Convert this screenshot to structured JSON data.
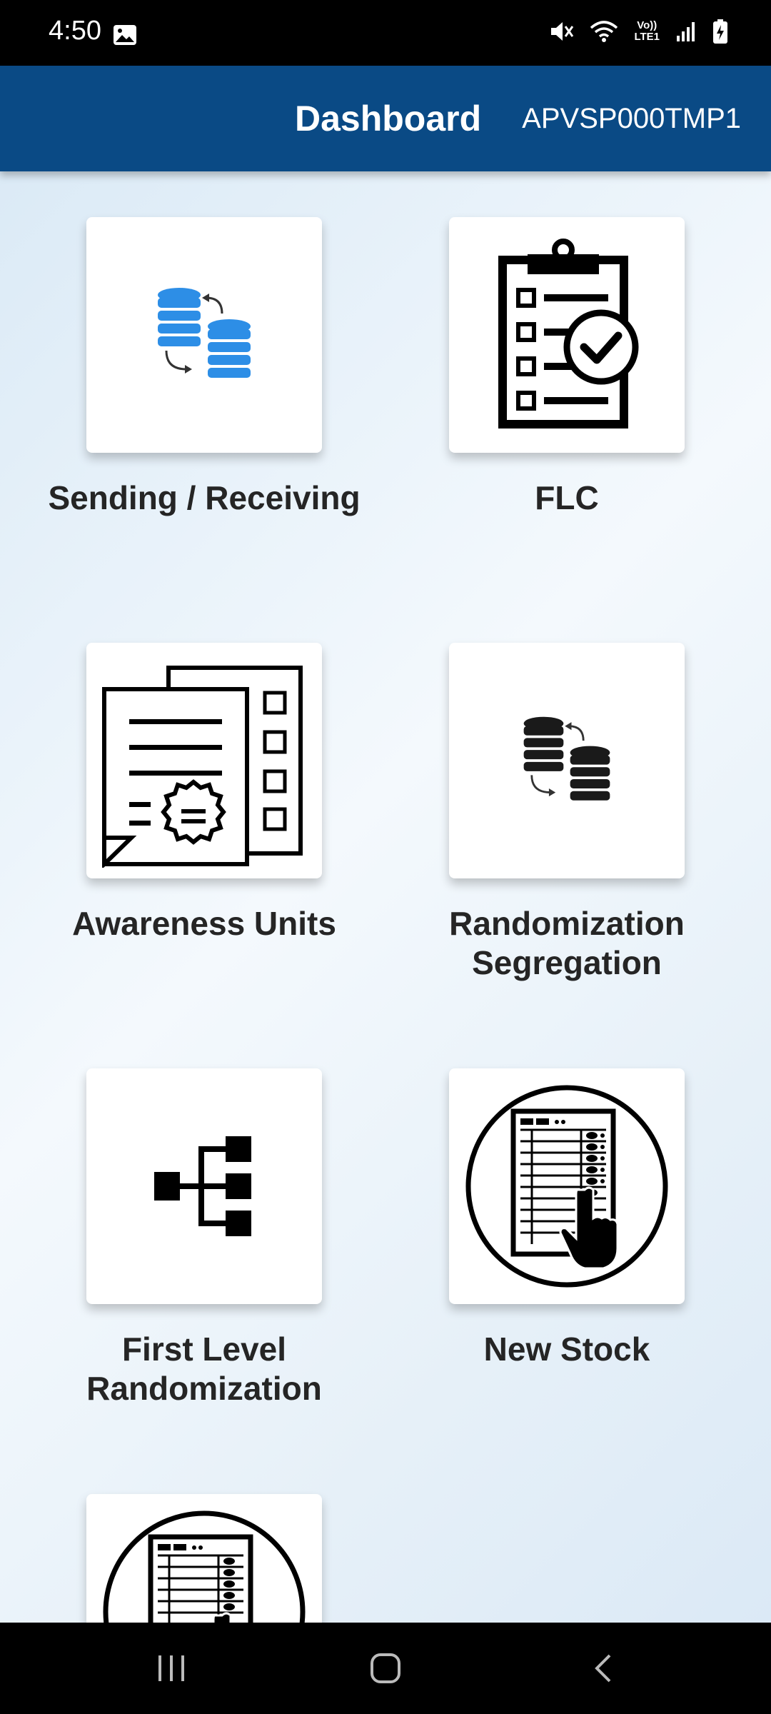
{
  "status_bar": {
    "time": "4:50",
    "icons": [
      "image-icon",
      "mute-icon",
      "wifi-icon",
      "volte-icon",
      "signal-icon",
      "battery-charging-icon"
    ],
    "volte_text_top": "Vo))",
    "volte_text_bottom": "LTE1"
  },
  "app_bar": {
    "title": "Dashboard",
    "user_id": "APVSP000TMP1",
    "color": "#0a4a85"
  },
  "tiles": [
    {
      "label": "Sending / Receiving",
      "icon": "database-transfer-blue-icon"
    },
    {
      "label": "FLC",
      "icon": "clipboard-checklist-icon"
    },
    {
      "label": "Awareness Units",
      "icon": "certificate-document-icon"
    },
    {
      "label": "Randomization Segregation",
      "icon": "database-transfer-black-icon"
    },
    {
      "label": "First Level Randomization",
      "icon": "hierarchy-tree-icon"
    },
    {
      "label": "New Stock",
      "icon": "voting-machine-icon"
    },
    {
      "label": "",
      "icon": "voting-machine-icon"
    }
  ],
  "nav_bar": {
    "buttons": [
      "recent-apps-icon",
      "home-icon",
      "back-icon"
    ]
  }
}
